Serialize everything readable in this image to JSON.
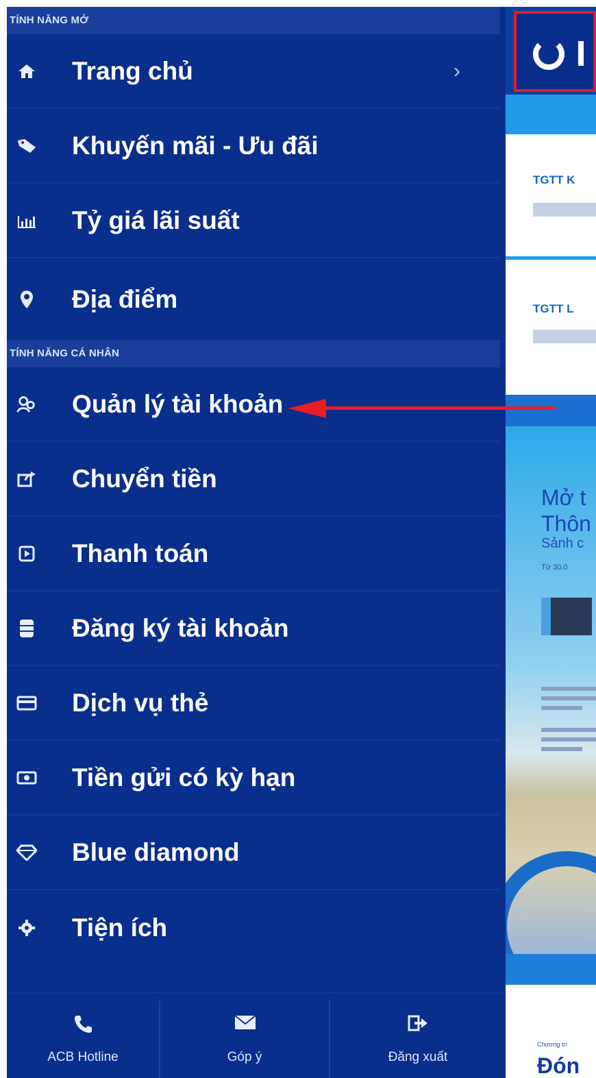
{
  "sidebar": {
    "section_open_title": "TÍNH NĂNG MỞ",
    "section_personal_title": "TÍNH NĂNG CÁ NHÂN",
    "open_items": [
      {
        "label": "Trang chủ",
        "icon": "home-icon",
        "chevron": "›"
      },
      {
        "label": "Khuyến mãi - Ưu đãi",
        "icon": "tag-icon"
      },
      {
        "label": "Tỷ giá lãi suất",
        "icon": "bar-chart-icon"
      },
      {
        "label": "Địa điểm",
        "icon": "location-pin-icon"
      }
    ],
    "personal_items": [
      {
        "label": "Quản lý tài khoản",
        "icon": "users-icon"
      },
      {
        "label": "Chuyển tiền",
        "icon": "transfer-icon"
      },
      {
        "label": "Thanh toán",
        "icon": "payment-icon"
      },
      {
        "label": "Đăng ký tài khoản",
        "icon": "database-icon"
      },
      {
        "label": "Dịch vụ thẻ",
        "icon": "credit-card-icon"
      },
      {
        "label": "Tiền gửi có kỳ hạn",
        "icon": "cash-icon"
      },
      {
        "label": "Blue diamond",
        "icon": "diamond-icon"
      },
      {
        "label": "Tiện ích",
        "icon": "gear-icon"
      }
    ],
    "bottom_bar": [
      {
        "label": "ACB Hotline",
        "icon": "phone-icon"
      },
      {
        "label": "Góp ý",
        "icon": "mail-icon"
      },
      {
        "label": "Đăng xuất",
        "icon": "logout-icon"
      }
    ]
  },
  "app": {
    "header_logo_letter": "I",
    "card1_title": "TGTT K",
    "card2_title": "TGTT L",
    "banner_title_line1": "Mở t",
    "banner_title_line2": "Thôn",
    "banner_subtitle": "Sảnh c",
    "banner_date": "Từ 30.0",
    "bottom_small": "Chương trì",
    "bottom_big": "Đón"
  },
  "colors": {
    "sidebar_bg": "#0a2e8c",
    "section_header_bg": "#1a3e9a",
    "accent_blue": "#1a8fe0",
    "annotation_red": "#ea1c24"
  }
}
